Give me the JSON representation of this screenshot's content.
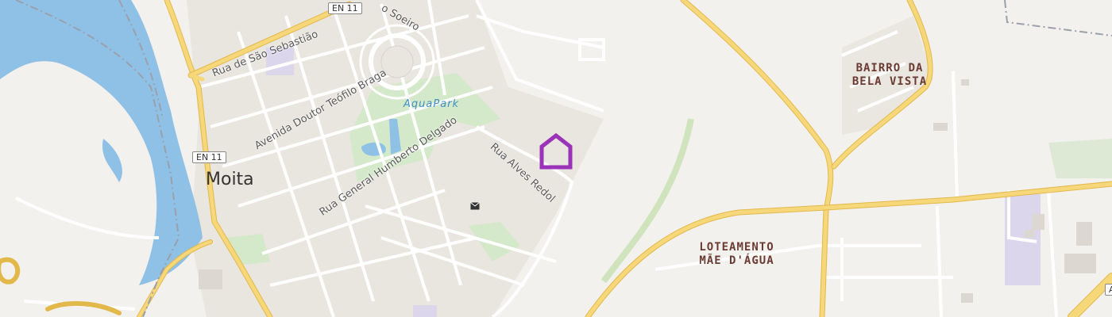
{
  "map": {
    "town": "Moita",
    "districts": {
      "bela_vista": [
        "BAIRRO DA",
        "BELA VISTA"
      ],
      "mae_dagua": [
        "LOTEAMENTO",
        "MÃE D'ÁGUA"
      ]
    },
    "park": "AquaPark",
    "road_shields": {
      "en11_top": "EN 11",
      "en11_mid": "EN 11",
      "a_right": "A"
    },
    "streets": {
      "sao_sebastiao": "Rua de São Sebastião",
      "teofilo_braga": "Avenida Doutor Teófilo Braga",
      "humberto_delgado": "Rua General Humberto Delgado",
      "alves_redol": "Rua Alves Redol",
      "soeiro": "o Soeiro"
    },
    "icons": {
      "marker": "home-marker-icon",
      "post_office": "mail-icon"
    },
    "colors": {
      "background": "#f3f1ed",
      "water": "#8fc1e6",
      "major_road": "#f6d87a",
      "major_road_casing": "#e2b84b",
      "park": "#d4e9c9",
      "marker": "#9b33b8",
      "district_label": "#6b3b33",
      "railway": "#9aa0ab"
    }
  }
}
